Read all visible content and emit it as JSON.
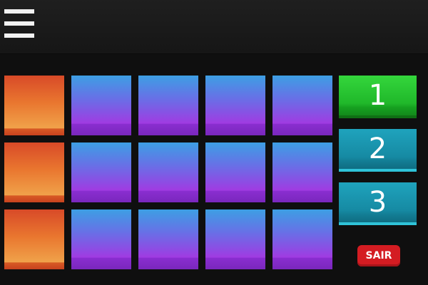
{
  "toolbar": {
    "menu_icon": "hamburger-menu-icon"
  },
  "pads": {
    "rows": 3,
    "columns": 5,
    "row_colors": [
      "orange",
      "purple",
      "purple",
      "purple",
      "purple"
    ],
    "colors": {
      "orange_top": "#d84a28",
      "orange_bottom": "#f0a24a",
      "purple_top": "#3d9fe4",
      "purple_bottom": "#a03be2"
    }
  },
  "bank_buttons": [
    {
      "label": "1",
      "state": "active",
      "color": "#20b82a"
    },
    {
      "label": "2",
      "state": "idle",
      "color": "#168aa3"
    },
    {
      "label": "3",
      "state": "idle",
      "color": "#168aa3"
    }
  ],
  "exit_button": {
    "label": "SAIR",
    "color": "#d41c22"
  }
}
